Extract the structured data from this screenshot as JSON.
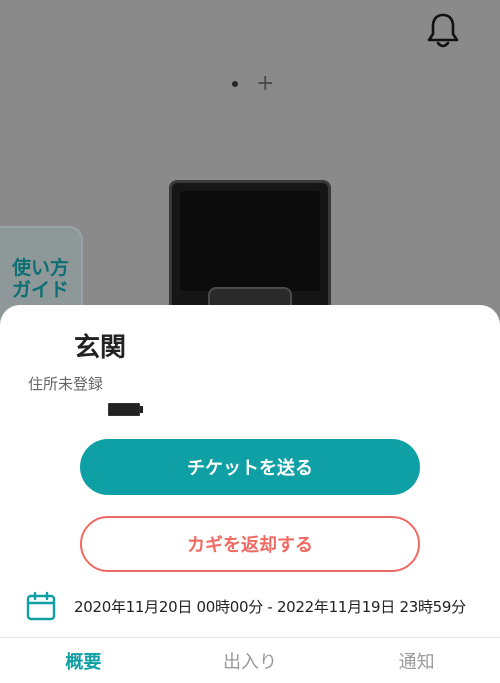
{
  "header": {
    "bell_icon": "bell-icon",
    "pager": {
      "dot": "•",
      "add": "+"
    }
  },
  "guide": {
    "line1": "使い方",
    "line2": "ガイド"
  },
  "device": {
    "name": "玄関",
    "address": "住所未登録",
    "battery_icon": "battery-icon"
  },
  "actions": {
    "send_ticket": "チケットを送る",
    "return_key": "カギを返却する"
  },
  "period": {
    "icon": "calendar-icon",
    "text": "2020年11月20日 00時00分 - 2022年11月19日 23時59分"
  },
  "tabs": [
    {
      "label": "概要",
      "active": true
    },
    {
      "label": "出入り",
      "active": false
    },
    {
      "label": "通知",
      "active": false
    }
  ],
  "colors": {
    "accent": "#0fa0a6",
    "danger": "#ef6a63",
    "overlay": "#8a8a8a"
  }
}
